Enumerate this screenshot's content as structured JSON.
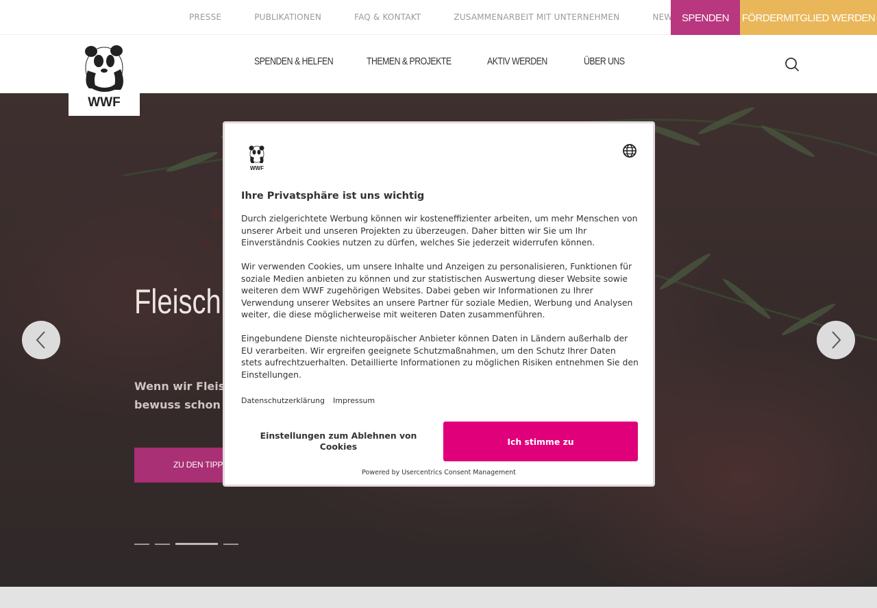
{
  "topbar": {
    "links": [
      "PRESSE",
      "PUBLIKATIONEN",
      "FAQ & KONTAKT",
      "ZUSAMMENARBEIT MIT UNTERNEHMEN",
      "NEWSLET"
    ],
    "spenden": "Spenden",
    "foerdermitglied": "Fördermitglied werden",
    "colors": {
      "spenden": "#b8377f",
      "foerdermitglied": "#e9b75a"
    }
  },
  "header": {
    "logo_text": "WWF",
    "nav": [
      "SPENDEN & HELFEN",
      "THEMEN & PROJEKTE",
      "AKTIV WERDEN",
      "ÜBER UNS"
    ],
    "search_icon": "search-icon"
  },
  "hero": {
    "title": "Fleisch: essen",
    "text": "Wenn wir Fleisch heißt, es bewuss schon viel gewon",
    "cta": "ZU DEN TIPPS",
    "slides": 4,
    "active_slide": 3,
    "prev_icon": "chevron-left-icon",
    "next_icon": "chevron-right-icon"
  },
  "consent": {
    "logo_text": "WWF",
    "language_icon": "globe-icon",
    "title": "Ihre Privatsphäre ist uns wichtig",
    "paragraphs": [
      "Durch zielgerichtete Werbung können wir kosteneffizienter arbeiten, um mehr Menschen von unserer Arbeit und unseren Projekten zu überzeugen. Daher bitten wir Sie um Ihr Einverständnis Cookies nutzen zu dürfen, welches Sie jederzeit widerrufen können.",
      "Wir verwenden Cookies, um unsere Inhalte und Anzeigen zu personalisieren, Funktionen für soziale Medien anbieten zu können und zur statistischen Auswertung dieser Website sowie weiteren dem WWF zugehörigen Websites. Dabei geben wir Informationen zu Ihrer Verwendung unserer Websites an unsere Partner für soziale Medien, Werbung und Analysen weiter, die diese möglicherweise mit weiteren Daten zusammenführen.",
      "Eingebundene Dienste nichteuropäischer Anbieter können Daten in Ländern außerhalb der EU verarbeiten. Wir ergreifen geeignete Schutzmaßnahmen, um den Schutz Ihrer Daten stets aufrechtzuerhalten. Detaillierte Informationen zu möglichen Risiken entnehmen Sie den Einstellungen."
    ],
    "links": [
      "Datenschutzerklärung",
      "Impressum"
    ],
    "decline": "Einstellungen zum Ablehnen von Cookies",
    "accept": "Ich stimme zu",
    "powered_by": "Powered by Usercentrics Consent Management",
    "accent": "#e0007a"
  }
}
